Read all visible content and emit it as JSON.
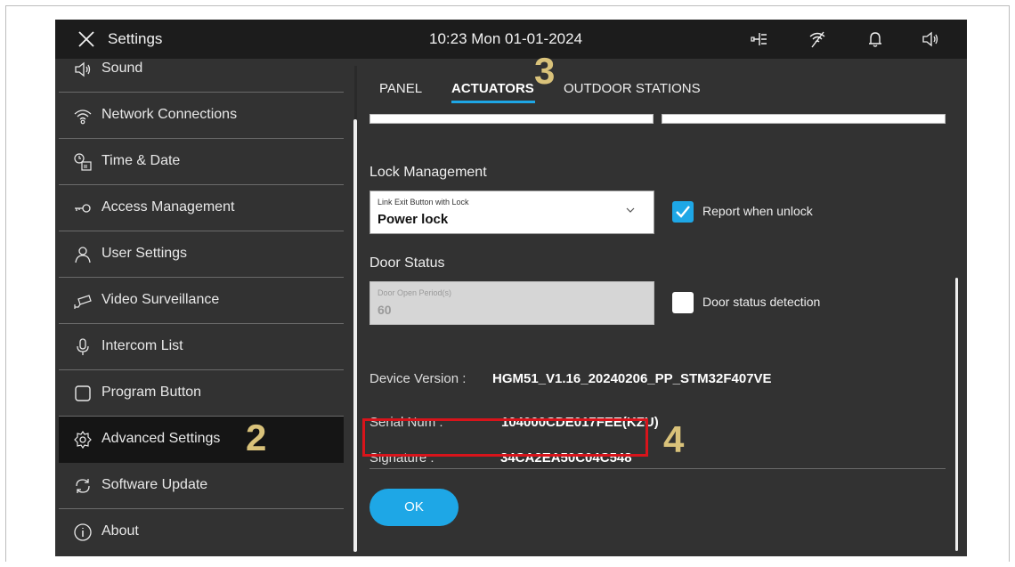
{
  "topbar": {
    "title": "Settings",
    "clock": "10:23  Mon 01-01-2024",
    "icons": [
      "close-icon",
      "network-topology-icon",
      "wifi-off-icon",
      "bell-icon",
      "speaker-icon"
    ]
  },
  "sidebar": {
    "items": [
      {
        "label": "Sound",
        "icon": "speaker-icon"
      },
      {
        "label": "Network Connections",
        "icon": "network-icon"
      },
      {
        "label": "Time & Date",
        "icon": "clock-calendar-icon"
      },
      {
        "label": "Access Management",
        "icon": "key-icon"
      },
      {
        "label": "User Settings",
        "icon": "user-icon"
      },
      {
        "label": "Video Surveillance",
        "icon": "camera-icon"
      },
      {
        "label": "Intercom List",
        "icon": "microphone-icon"
      },
      {
        "label": "Program Button",
        "icon": "square-button-icon"
      },
      {
        "label": "Advanced Settings",
        "icon": "gear-icon",
        "active": true
      },
      {
        "label": "Software Update",
        "icon": "refresh-icon"
      },
      {
        "label": "About",
        "icon": "info-icon"
      }
    ]
  },
  "tabs": [
    {
      "label": "PANEL"
    },
    {
      "label": "ACTUATORS",
      "active": true
    },
    {
      "label": "OUTDOOR STATIONS"
    }
  ],
  "lock": {
    "section_title": "Lock Management",
    "field_label": "Link Exit Button with Lock",
    "field_value": "Power lock",
    "checkbox_label": "Report when unlock",
    "checkbox_checked": true
  },
  "door": {
    "section_title": "Door Status",
    "field_label": "Door Open Period(s)",
    "field_value": "60",
    "field_disabled": true,
    "checkbox_label": "Door status detection",
    "checkbox_checked": false
  },
  "info": {
    "device_version_label": "Device Version :",
    "device_version_value": "HGM51_V1.16_20240206_PP_STM32F407VE",
    "serial_label": "Serial Num :",
    "serial_value": "104000CDE017FEE(KZU)",
    "signature_label": "Signature :",
    "signature_value": "34CA2EA50C04C548"
  },
  "ok_button": "OK",
  "annotations": {
    "two": "2",
    "three": "3",
    "four": "4"
  },
  "colors": {
    "accent": "#1ea7e6",
    "highlight": "#d8141b",
    "annotation": "#d9c27a",
    "background": "#323232",
    "topbar": "#1c1c1c"
  }
}
